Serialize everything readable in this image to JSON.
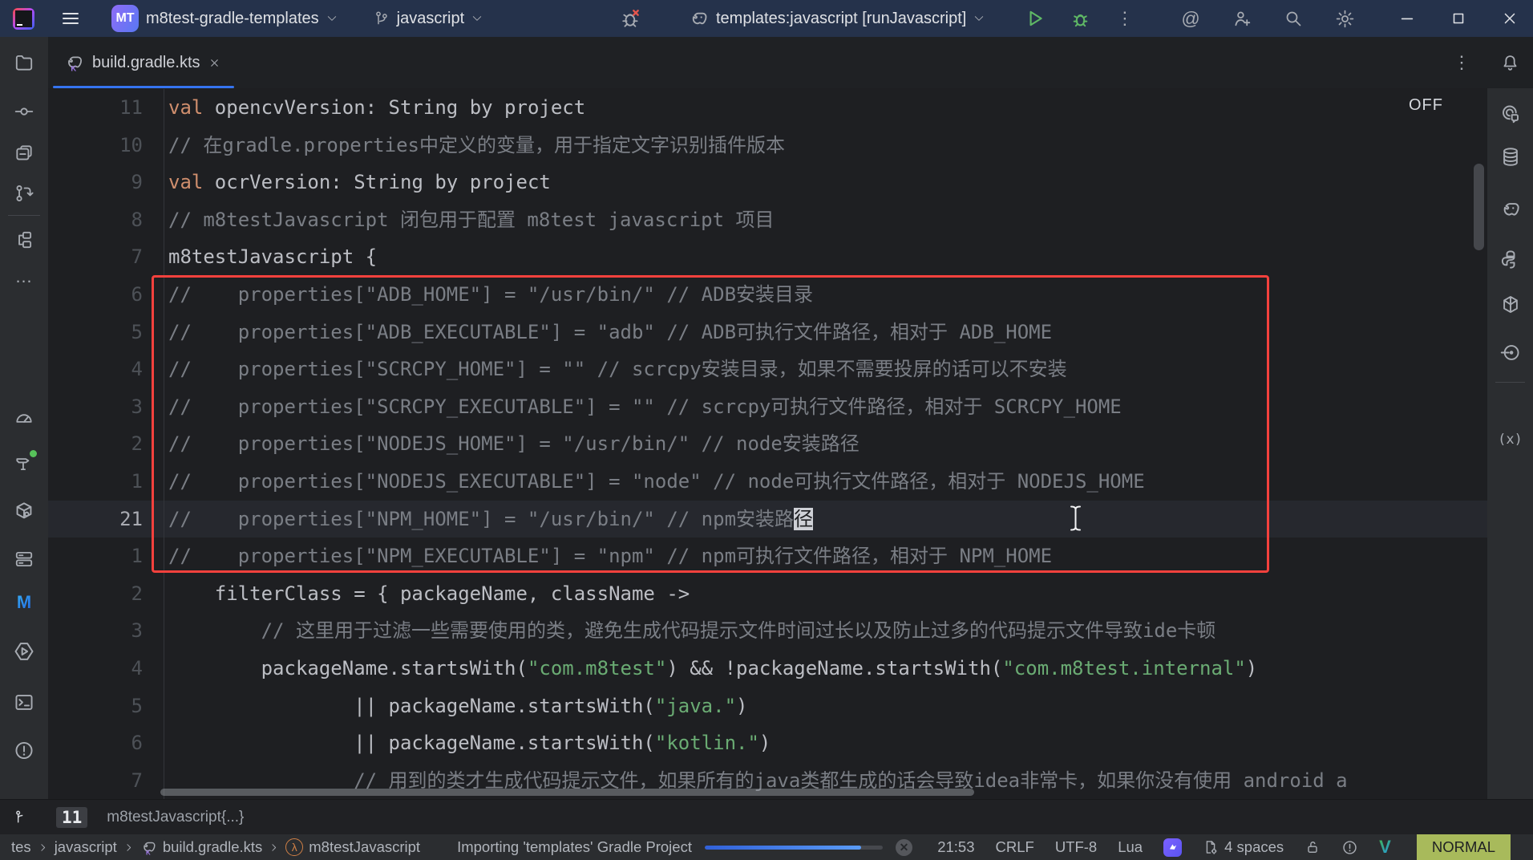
{
  "titlebar": {
    "project_name": "m8test-gradle-templates",
    "project_avatar": "MT",
    "branch": "javascript",
    "run_config": "templates:javascript [runJavascript]"
  },
  "tabrow": {
    "active_tab": "build.gradle.kts"
  },
  "editor": {
    "off_label": "OFF",
    "lines": [
      {
        "n": "11",
        "segs": [
          [
            "kw",
            "val"
          ],
          [
            "txt",
            " opencvVersion: String by project"
          ]
        ]
      },
      {
        "n": "10",
        "segs": [
          [
            "cmt",
            "// 在gradle.properties中定义的变量，用于指定文字识别插件版本"
          ]
        ]
      },
      {
        "n": "9",
        "segs": [
          [
            "kw",
            "val"
          ],
          [
            "txt",
            " ocrVersion: String by project"
          ]
        ]
      },
      {
        "n": "8",
        "segs": [
          [
            "cmt",
            "// m8testJavascript 闭包用于配置 m8test javascript 项目"
          ]
        ]
      },
      {
        "n": "7",
        "segs": [
          [
            "txt",
            "m8testJavascript {"
          ]
        ]
      },
      {
        "n": "6",
        "segs": [
          [
            "cmt",
            "//    properties[\"ADB_HOME\"] = \"/usr/bin/\" // ADB安装目录"
          ]
        ]
      },
      {
        "n": "5",
        "segs": [
          [
            "cmt",
            "//    properties[\"ADB_EXECUTABLE\"] = \"adb\" // ADB可执行文件路径，相对于 ADB_HOME"
          ]
        ]
      },
      {
        "n": "4",
        "segs": [
          [
            "cmt",
            "//    properties[\"SCRCPY_HOME\"] = \"\" // scrcpy安装目录，如果不需要投屏的话可以不安装"
          ]
        ]
      },
      {
        "n": "3",
        "segs": [
          [
            "cmt",
            "//    properties[\"SCRCPY_EXECUTABLE\"] = \"\" // scrcpy可执行文件路径，相对于 SCRCPY_HOME"
          ]
        ]
      },
      {
        "n": "2",
        "segs": [
          [
            "cmt",
            "//    properties[\"NODEJS_HOME\"] = \"/usr/bin/\" // node安装路径"
          ]
        ]
      },
      {
        "n": "1",
        "segs": [
          [
            "cmt",
            "//    properties[\"NODEJS_EXECUTABLE\"] = \"node\" // node可执行文件路径，相对于 NODEJS_HOME"
          ]
        ]
      },
      {
        "n": "21",
        "current": true,
        "segs": [
          [
            "cmt",
            "//    properties[\"NPM_HOME\"] = \"/usr/bin/\" // npm安装路"
          ]
        ],
        "cursor": "径"
      },
      {
        "n": "1",
        "segs": [
          [
            "cmt",
            "//    properties[\"NPM_EXECUTABLE\"] = \"npm\" // npm可执行文件路径，相对于 NPM_HOME"
          ]
        ]
      },
      {
        "n": "2",
        "segs": [
          [
            "txt",
            "    filterClass = { packageName, className ->"
          ]
        ]
      },
      {
        "n": "3",
        "segs": [
          [
            "cmt",
            "        // 这里用于过滤一些需要使用的类，避免生成代码提示文件时间过长以及防止过多的代码提示文件导致ide卡顿"
          ]
        ]
      },
      {
        "n": "4",
        "segs": [
          [
            "txt",
            "        packageName.startsWith("
          ],
          [
            "str",
            "\"com.m8test\""
          ],
          [
            "txt",
            ") && !packageName.startsWith("
          ],
          [
            "str",
            "\"com.m8test.internal\""
          ],
          [
            "txt",
            ")"
          ]
        ]
      },
      {
        "n": "5",
        "segs": [
          [
            "txt",
            "                || packageName.startsWith("
          ],
          [
            "str",
            "\"java.\""
          ],
          [
            "txt",
            ")"
          ]
        ]
      },
      {
        "n": "6",
        "segs": [
          [
            "txt",
            "                || packageName.startsWith("
          ],
          [
            "str",
            "\"kotlin.\""
          ],
          [
            "txt",
            ")"
          ]
        ]
      },
      {
        "n": "7",
        "segs": [
          [
            "cmt",
            "                // 用到的类才生成代码提示文件，如果所有的java类都生成的话会导致idea非常卡，如果你没有使用 android a"
          ]
        ]
      }
    ]
  },
  "sticky_line": {
    "line_number": "11",
    "label": "m8testJavascript{...}"
  },
  "statusbar": {
    "breadcrumbs": [
      "tes",
      "javascript",
      "build.gradle.kts",
      "m8testJavascript"
    ],
    "progress_label": "Importing 'templates' Gradle Project",
    "caret_position": "21:53",
    "line_separator": "CRLF",
    "encoding": "UTF-8",
    "language": "Lua",
    "indent": "4 spaces",
    "vim_mode": "NORMAL"
  },
  "colors": {
    "accent_blue": "#3574f0",
    "annotation_red": "#f5413d",
    "run_green": "#5fb865",
    "keyword": "#cf8e6d",
    "comment": "#7a7e85",
    "string": "#6aab73",
    "vim_badge": "#a8ba5b",
    "titlebar_bg": "#25324b",
    "editor_bg": "#1e1f22"
  }
}
